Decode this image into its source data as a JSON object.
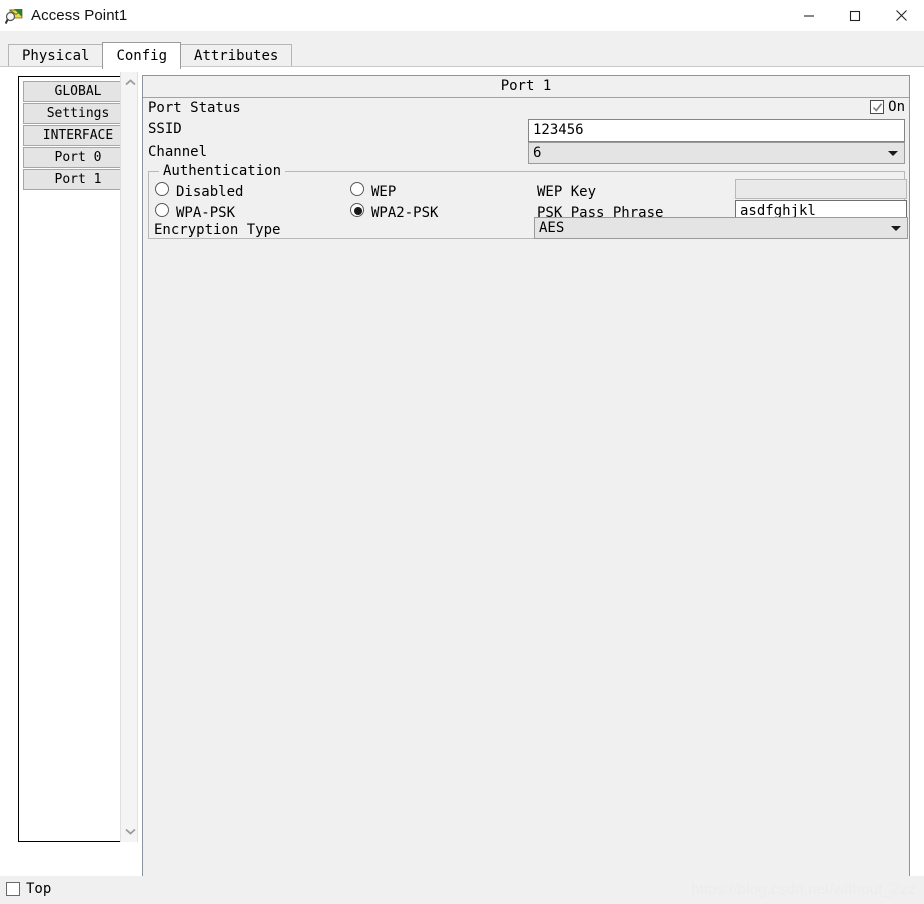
{
  "window": {
    "title": "Access Point1",
    "icon": "packet-tracer-icon",
    "controls": {
      "minimize": "minimize-icon",
      "maximize": "maximize-icon",
      "close": "close-icon"
    }
  },
  "tabs": [
    {
      "label": "Physical",
      "active": false
    },
    {
      "label": "Config",
      "active": true
    },
    {
      "label": "Attributes",
      "active": false
    }
  ],
  "sidebar": {
    "items": [
      {
        "label": "GLOBAL"
      },
      {
        "label": "Settings"
      },
      {
        "label": "INTERFACE"
      },
      {
        "label": "Port 0"
      },
      {
        "label": "Port 1"
      }
    ],
    "scrollbar": {
      "up_icon": "chevron-up-icon",
      "down_icon": "chevron-down-icon"
    }
  },
  "main": {
    "panel_title": "Port 1",
    "port_status": {
      "label": "Port Status",
      "checked": true,
      "state_label": "On"
    },
    "ssid": {
      "label": "SSID",
      "value": "123456"
    },
    "channel": {
      "label": "Channel",
      "value": "6"
    },
    "authentication": {
      "legend": "Authentication",
      "options": [
        {
          "label": "Disabled",
          "selected": false
        },
        {
          "label": "WEP",
          "selected": false
        },
        {
          "label": "WPA-PSK",
          "selected": false
        },
        {
          "label": "WPA2-PSK",
          "selected": true
        }
      ],
      "wep_key": {
        "label": "WEP Key",
        "value": "",
        "disabled": true
      },
      "psk_pass_phrase": {
        "label": "PSK Pass Phrase",
        "value": "asdfghjkl"
      },
      "encryption_type": {
        "label": "Encryption Type",
        "value": "AES"
      }
    }
  },
  "bottom": {
    "top_checkbox": {
      "label": "Top",
      "checked": false
    },
    "watermark": "https://blog.csdn.net/without_Zzz"
  }
}
